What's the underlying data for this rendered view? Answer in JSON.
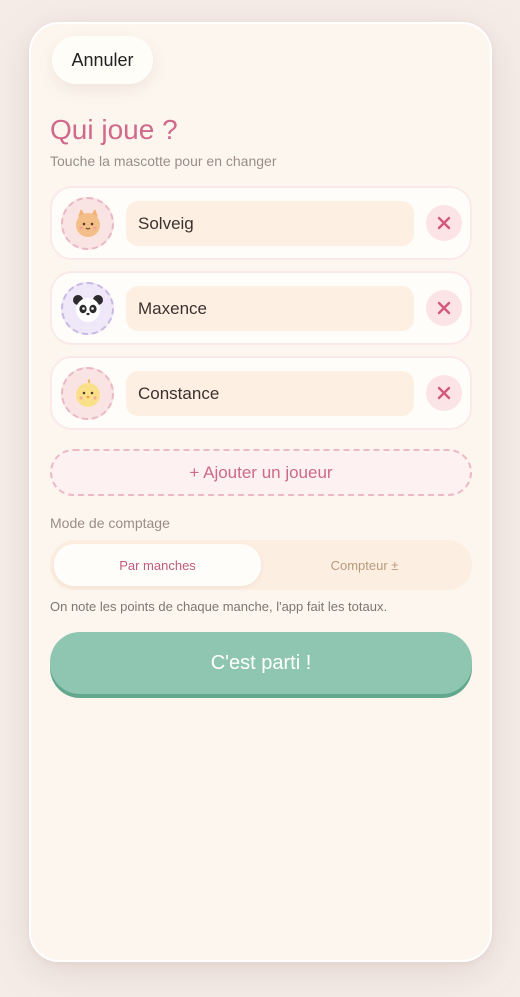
{
  "header": {
    "cancel_label": "Annuler"
  },
  "setup": {
    "title": "Qui joue ?",
    "subtitle": "Touche la mascotte pour en changer"
  },
  "players": [
    {
      "name": "Solveig",
      "mascot": "cat-icon"
    },
    {
      "name": "Maxence",
      "mascot": "panda-icon"
    },
    {
      "name": "Constance",
      "mascot": "chick-icon"
    }
  ],
  "add_player_label": "+ Ajouter un joueur",
  "mode": {
    "label": "Mode de comptage",
    "options": [
      "Par manches",
      "Compteur ±"
    ],
    "selected": "Par manches",
    "help": "On note les points de chaque manche, l'app fait les totaux."
  },
  "start_label": "C'est parti !",
  "colors": {
    "accent_pink": "#cf6a8c",
    "mint": "#8fc6b2",
    "background": "#fdf6ef"
  }
}
